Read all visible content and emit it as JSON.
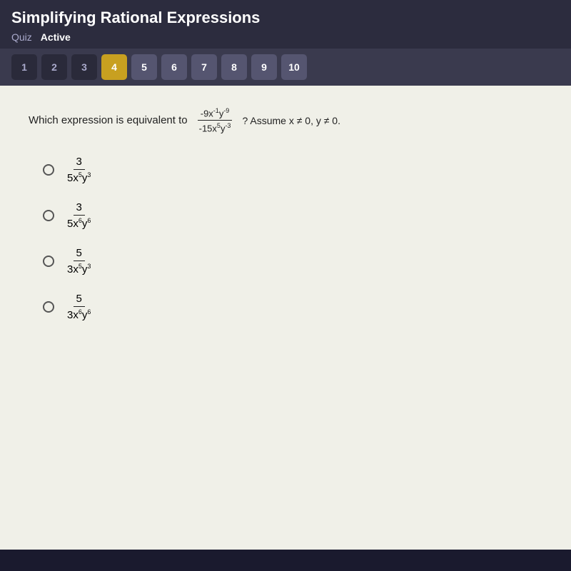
{
  "header": {
    "title": "Simplifying Rational Expressions",
    "quiz_label": "Quiz",
    "active_label": "Active"
  },
  "nav": {
    "buttons": [
      {
        "label": "1",
        "state": "dark"
      },
      {
        "label": "2",
        "state": "dark"
      },
      {
        "label": "3",
        "state": "dark"
      },
      {
        "label": "4",
        "state": "active"
      },
      {
        "label": "5",
        "state": "normal"
      },
      {
        "label": "6",
        "state": "normal"
      },
      {
        "label": "7",
        "state": "normal"
      },
      {
        "label": "8",
        "state": "normal"
      },
      {
        "label": "9",
        "state": "normal"
      },
      {
        "label": "10",
        "state": "normal"
      }
    ]
  },
  "question": {
    "intro": "Which expression is equivalent to",
    "expression_numerator": "-9x⁻¹y⁻⁹",
    "expression_denominator": "-15x⁵y⁻³",
    "assume": "? Assume x ≠ 0, y ≠ 0."
  },
  "options": [
    {
      "numerator": "3",
      "denominator": "5x⁵y³"
    },
    {
      "numerator": "3",
      "denominator": "5x⁶y⁶"
    },
    {
      "numerator": "5",
      "denominator": "3x⁵y³"
    },
    {
      "numerator": "5",
      "denominator": "3x⁶y⁶"
    }
  ]
}
